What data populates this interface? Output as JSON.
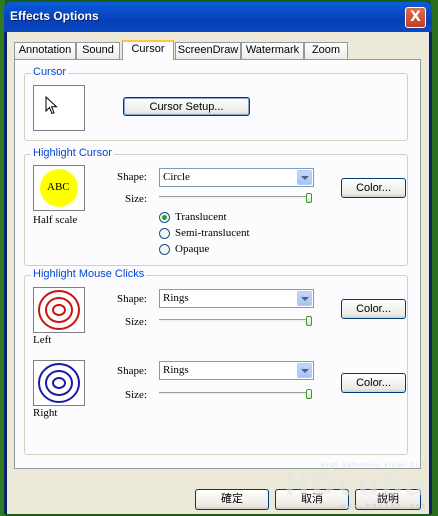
{
  "window": {
    "title": "Effects Options",
    "close_glyph": "X"
  },
  "tabs": [
    {
      "label": "Annotation"
    },
    {
      "label": "Sound"
    },
    {
      "label": "Cursor",
      "active": true
    },
    {
      "label": "ScreenDraw"
    },
    {
      "label": "Watermark"
    },
    {
      "label": "Zoom"
    }
  ],
  "cursor_group": {
    "label": "Cursor",
    "preview_icon": "arrow-cursor-icon",
    "setup_button": "Cursor Setup..."
  },
  "highlight_cursor": {
    "label": "Highlight Cursor",
    "preview_text": "ABC",
    "preview_color": "#ffff00",
    "caption": "Half scale",
    "shape_label": "Shape:",
    "shape_value": "Circle",
    "size_label": "Size:",
    "size_value": 1.0,
    "color_button": "Color...",
    "options": [
      {
        "label": "Translucent",
        "checked": true
      },
      {
        "label": "Semi-translucent",
        "checked": false
      },
      {
        "label": "Opaque",
        "checked": false
      }
    ]
  },
  "highlight_clicks": {
    "label": "Highlight Mouse Clicks",
    "left": {
      "caption": "Left",
      "ring_color": "#cc1111",
      "shape_label": "Shape:",
      "shape_value": "Rings",
      "size_label": "Size:",
      "size_value": 1.0,
      "color_button": "Color..."
    },
    "right": {
      "caption": "Right",
      "ring_color": "#1a1aa8",
      "shape_label": "Shape:",
      "shape_value": "Rings",
      "size_label": "Size:",
      "size_value": 1.0,
      "color_button": "Color..."
    }
  },
  "footer": {
    "ok_label": "確定",
    "cancel_label": "取消",
    "help_label": "說明"
  },
  "watermark": {
    "tagline": "High Definition Vision Club",
    "logo": "HDcuba",
    "url": "www.hdcuba.net"
  }
}
